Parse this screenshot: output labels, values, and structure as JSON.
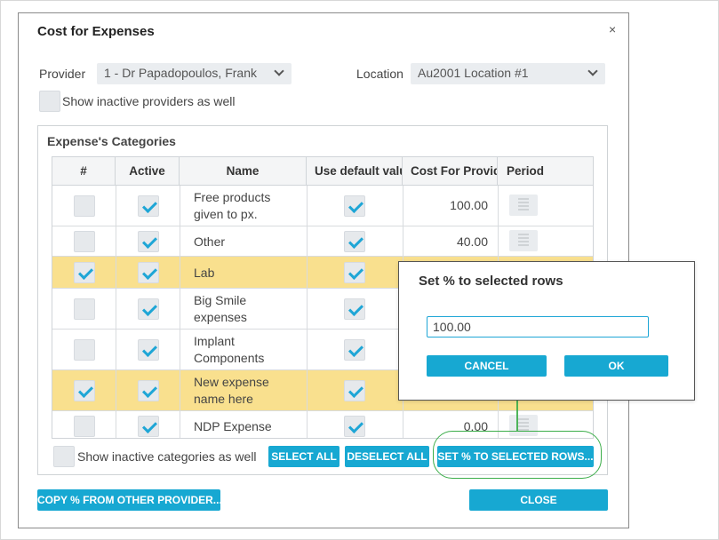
{
  "dialog": {
    "title": "Cost for Expenses",
    "close_glyph": "×"
  },
  "filters": {
    "provider_label": "Provider",
    "provider_value": "1 - Dr Papadopoulos, Frank",
    "location_label": "Location",
    "location_value": "Au2001 Location #1",
    "show_inactive_providers_label": "Show inactive providers as well",
    "show_inactive_providers_checked": false
  },
  "categories": {
    "group_title": "Expense's Categories",
    "columns": [
      "#",
      "Active",
      "Name",
      "Use default value",
      "Cost For Provider",
      "Period"
    ],
    "rows": [
      {
        "selected": false,
        "active": true,
        "name_line1": "Free products",
        "name_line2": "given to px.",
        "use_default": true,
        "cost": "100.00"
      },
      {
        "selected": false,
        "active": true,
        "name_line1": "Other",
        "name_line2": "",
        "use_default": true,
        "cost": "40.00"
      },
      {
        "selected": true,
        "active": true,
        "name_line1": "Lab",
        "name_line2": "",
        "use_default": true,
        "cost": ""
      },
      {
        "selected": false,
        "active": true,
        "name_line1": "Big Smile",
        "name_line2": "expenses",
        "use_default": true,
        "cost": ""
      },
      {
        "selected": false,
        "active": true,
        "name_line1": "Implant",
        "name_line2": "Components",
        "use_default": true,
        "cost": ""
      },
      {
        "selected": true,
        "active": true,
        "name_line1": "New expense",
        "name_line2": "name here",
        "use_default": true,
        "cost": ""
      },
      {
        "selected": false,
        "active": true,
        "name_line1": "NDP Expense",
        "name_line2": "",
        "use_default": true,
        "cost": "0.00"
      }
    ],
    "show_inactive_categories_label": "Show inactive categories as well",
    "select_all_label": "SELECT ALL",
    "deselect_all_label": "DESELECT ALL",
    "set_percent_label": "SET % TO SELECTED ROWS..."
  },
  "footer": {
    "copy_label": "COPY % FROM OTHER PROVIDER...",
    "close_label": "CLOSE"
  },
  "popup": {
    "title": "Set % to selected rows",
    "input_value": "100.00",
    "cancel_label": "CANCEL",
    "ok_label": "OK"
  },
  "colors": {
    "accent": "#17a8d2",
    "selected_row": "#f9e08e",
    "annotation": "#3cae4a"
  }
}
